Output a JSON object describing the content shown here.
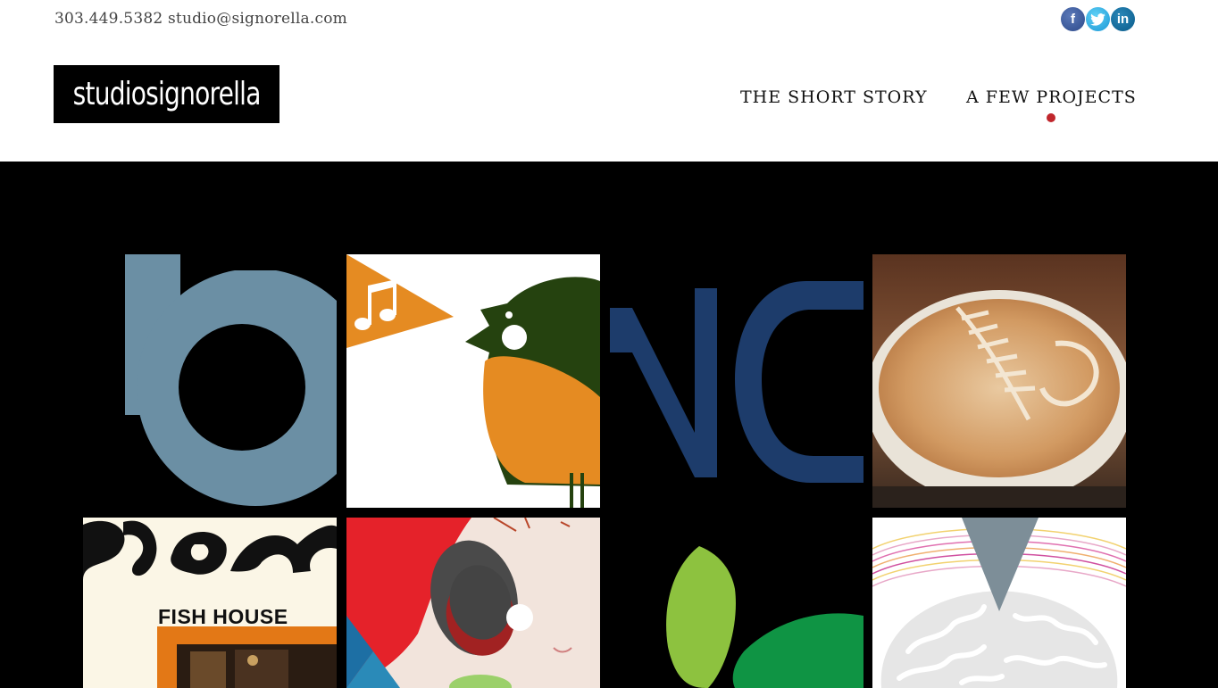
{
  "header": {
    "phone": "303.449.5382",
    "email": "studio@signorella.com",
    "logo_text": "studiosignorella",
    "social": [
      {
        "name": "facebook",
        "glyph": "f",
        "color": "#3b5998"
      },
      {
        "name": "twitter",
        "glyph": "t",
        "color": "#2aa9e0"
      },
      {
        "name": "linkedin",
        "glyph": "in",
        "color": "#0e76a8"
      }
    ]
  },
  "nav": {
    "items": [
      {
        "label": "THE SHORT STORY",
        "active": false
      },
      {
        "label": "A FEW PROJECTS",
        "active": true
      }
    ],
    "active_indicator_color": "#c0262c"
  },
  "gallery": {
    "background": "#000000",
    "tiles": [
      {
        "name": "b-logo-project"
      },
      {
        "name": "singing-bird-project"
      },
      {
        "name": "nc-letters-project"
      },
      {
        "name": "latte-art-project"
      },
      {
        "name": "fish-house-project",
        "text": "FISH HOUSE"
      },
      {
        "name": "anime-girl-project"
      },
      {
        "name": "green-leaves-project"
      },
      {
        "name": "brain-arrow-project"
      }
    ]
  }
}
